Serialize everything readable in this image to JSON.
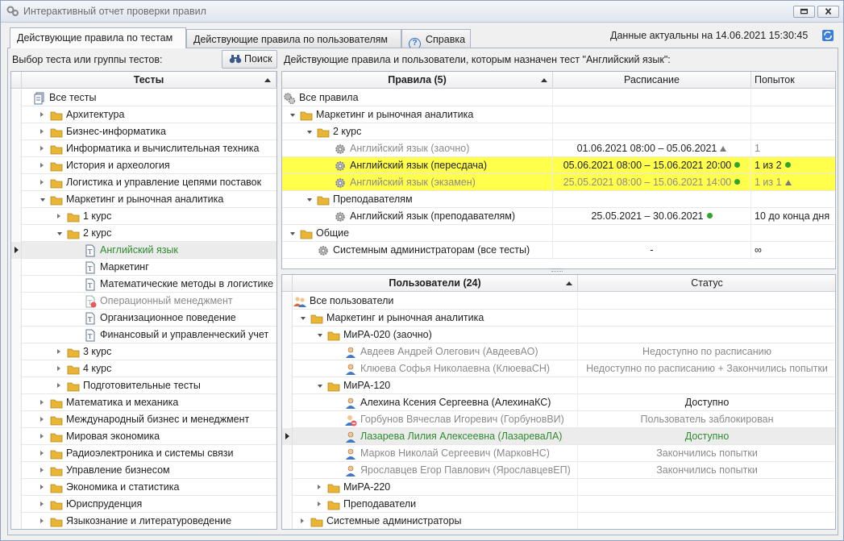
{
  "window": {
    "title": "Интерактивный отчет проверки правил"
  },
  "tabs": [
    {
      "label": "Действующие правила по тестам"
    },
    {
      "label": "Действующие правила по пользователям"
    },
    {
      "label": "Справка"
    }
  ],
  "data_actual": "Данные актуальны на 14.06.2021 15:30:45",
  "left": {
    "label": "Выбор теста или группы тестов:",
    "search_label": "Поиск",
    "column": "Тесты",
    "items": [
      "Все тесты",
      "Архитектура",
      "Бизнес-информатика",
      "Информатика и вычислительная техника",
      "История и археология",
      "Логистика и управление цепями поставок",
      "Маркетинг и рыночная аналитика",
      "1 курс",
      "2 курс",
      "Английский язык",
      "Маркетинг",
      "Математические методы в логистике",
      "Операционный менеджмент",
      "Организационное поведение",
      "Финансовый и управленческий учет",
      "3 курс",
      "4 курс",
      "Подготовительные тесты",
      "Математика и механика",
      "Международный бизнес и менеджмент",
      "Мировая экономика",
      "Радиоэлектроника и системы связи",
      "Управление бизнесом",
      "Экономика и статистика",
      "Юриспруденция",
      "Языкознание и литературоведение"
    ]
  },
  "rules": {
    "label": "Действующие правила и пользователи, которым назначен тест \"Английский язык\":",
    "columns": {
      "name": "Правила (5)",
      "schedule": "Расписание",
      "attempts": "Попыток"
    },
    "rows": [
      {
        "name": "Все правила",
        "schedule": "",
        "attempts": ""
      },
      {
        "name": "Маркетинг и рыночная аналитика",
        "schedule": "",
        "attempts": ""
      },
      {
        "name": "2 курс",
        "schedule": "",
        "attempts": ""
      },
      {
        "name": "Английский язык (заочно)",
        "schedule": "01.06.2021 08:00 – 05.06.2021",
        "attempts": "1"
      },
      {
        "name": "Английский язык (пересдача)",
        "schedule": "05.06.2021 08:00 – 15.06.2021 20:00",
        "attempts": "1 из 2"
      },
      {
        "name": "Английский язык (экзамен)",
        "schedule": "25.05.2021 08:00 – 15.06.2021 14:00",
        "attempts": "1 из 1"
      },
      {
        "name": "Преподавателям",
        "schedule": "",
        "attempts": ""
      },
      {
        "name": "Английский язык (преподавателям)",
        "schedule": "25.05.2021 – 30.06.2021",
        "attempts": "10 до конца дня"
      },
      {
        "name": "Общие",
        "schedule": "",
        "attempts": ""
      },
      {
        "name": "Системным администраторам (все тесты)",
        "schedule": "-",
        "attempts": "∞"
      }
    ]
  },
  "users": {
    "columns": {
      "name": "Пользователи (24)",
      "status": "Статус"
    },
    "rows": [
      {
        "name": "Все пользователи",
        "status": ""
      },
      {
        "name": "Маркетинг и рыночная аналитика",
        "status": ""
      },
      {
        "name": "МиРА-020 (заочно)",
        "status": ""
      },
      {
        "name": "Авдеев Андрей Олегович (АвдеевАО)",
        "status": "Недоступно по расписанию"
      },
      {
        "name": "Клюева Софья Николаевна (КлюеваСН)",
        "status": "Недоступно по расписанию + Закончились попытки"
      },
      {
        "name": "МиРА-120",
        "status": ""
      },
      {
        "name": "Алехина Ксения Сергеевна (АлехинаКС)",
        "status": "Доступно"
      },
      {
        "name": "Горбунов Вячеслав Игоревич (ГорбуновВИ)",
        "status": "Пользователь заблокирован"
      },
      {
        "name": "Лазарева Лилия Алексеевна (ЛазареваЛА)",
        "status": "Доступно"
      },
      {
        "name": "Марков Николай Сергеевич (МарковНС)",
        "status": "Закончились попытки"
      },
      {
        "name": "Ярославцев Егор Павлович (ЯрославцевЕП)",
        "status": "Закончились попытки"
      },
      {
        "name": "МиРА-220",
        "status": ""
      },
      {
        "name": "Преподаватели",
        "status": ""
      },
      {
        "name": "Системные администраторы",
        "status": ""
      }
    ]
  },
  "colors": {
    "highlight": "#ffff4c",
    "green_text": "#2e8b2e",
    "gray_text": "#8a8a8a",
    "folder": "#e8b634",
    "status_ok": "#2ea52e"
  }
}
